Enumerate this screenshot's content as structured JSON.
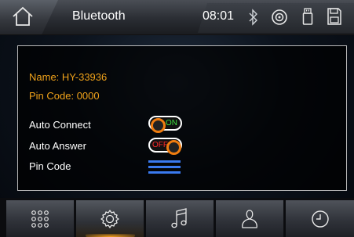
{
  "header": {
    "title": "Bluetooth",
    "time": "08:01",
    "icons": [
      "home-icon",
      "bluetooth-icon",
      "disc-icon",
      "usb-icon",
      "sd-card-icon"
    ]
  },
  "device": {
    "name_line": "Name: HY-33936",
    "pin_line": "Pin Code: 0000"
  },
  "settings": {
    "auto_connect_label": "Auto Connect",
    "auto_connect_state": "ON",
    "auto_answer_label": "Auto Answer",
    "auto_answer_state": "OFF",
    "pin_code_label": "Pin Code"
  },
  "bottom_tabs": [
    {
      "name": "apps",
      "icon": "grid-icon"
    },
    {
      "name": "settings",
      "icon": "gear-icon",
      "active": true
    },
    {
      "name": "music",
      "icon": "music-note-icon"
    },
    {
      "name": "contacts",
      "icon": "person-icon"
    },
    {
      "name": "clock",
      "icon": "clock-icon"
    }
  ],
  "colors": {
    "accent": "#f07d10",
    "label_orange": "#f0a21a",
    "menu_blue": "#3a7af0",
    "on_green": "#3ee23e",
    "off_red": "#ff2a2a"
  }
}
